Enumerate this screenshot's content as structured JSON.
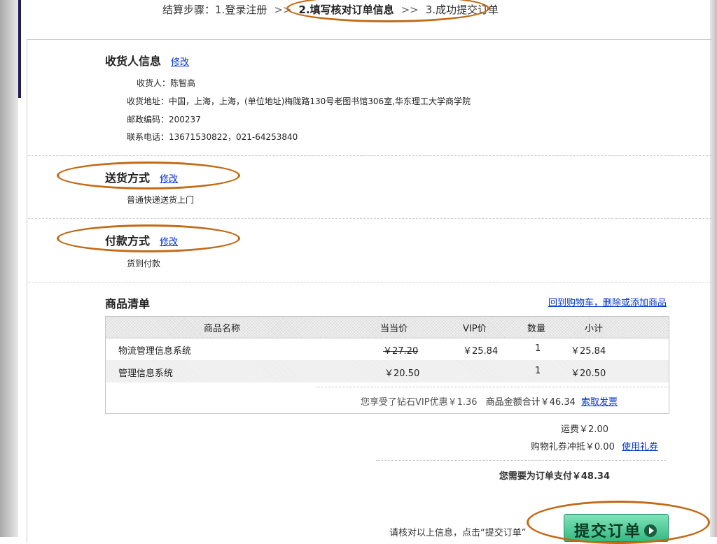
{
  "steps": {
    "label": "结算步骤：",
    "step1": "1.登录注册",
    "sep1": ">>",
    "step2": "2.填写核对订单信息",
    "sep2": ">>",
    "step3": "3.成功提交订单"
  },
  "consignee": {
    "title": "收货人信息",
    "edit": "修改",
    "name_label": "收货人：",
    "name": "陈智高",
    "address_label": "收货地址：",
    "address": "中国，上海，上海，(单位地址)梅陇路130号老图书馆306室,华东理工大学商学院",
    "zip_label": "邮政编码：",
    "zip": "200237",
    "phone_label": "联系电话：",
    "phone": "13671530822，021-64253840"
  },
  "delivery": {
    "title": "送货方式",
    "edit": "修改",
    "value": "普通快递送货上门"
  },
  "payment": {
    "title": "付款方式",
    "edit": "修改",
    "value": "货到付款"
  },
  "items": {
    "title": "商品清单",
    "back_link": "回到购物车，删除或添加商品",
    "columns": [
      "商品名称",
      "当当价",
      "VIP价",
      "数量",
      "小计"
    ],
    "rows": [
      {
        "name": "物流管理信息系统",
        "price": "￥27.20",
        "vip": "￥25.84",
        "qty": "1",
        "subtotal": "￥25.84"
      },
      {
        "name": "管理信息系统",
        "price": "￥20.50",
        "vip": "",
        "qty": "1",
        "subtotal": "￥20.50"
      }
    ],
    "discount_text": "您享受了钻石VIP优惠￥1.36",
    "amount_text": "商品金额合计￥46.34",
    "invoice_link": "索取发票"
  },
  "summary": {
    "shipping": "运费￥2.00",
    "coupon": "购物礼券冲抵￥0.00",
    "coupon_link": "使用礼券",
    "total": "您需要为订单支付￥48.34"
  },
  "submit": {
    "hint": "请核对以上信息，点击“提交订单”",
    "button": "提交订单"
  },
  "colors": {
    "annotation": "#c26a16",
    "link": "#0033cc",
    "button": "#35b982"
  }
}
